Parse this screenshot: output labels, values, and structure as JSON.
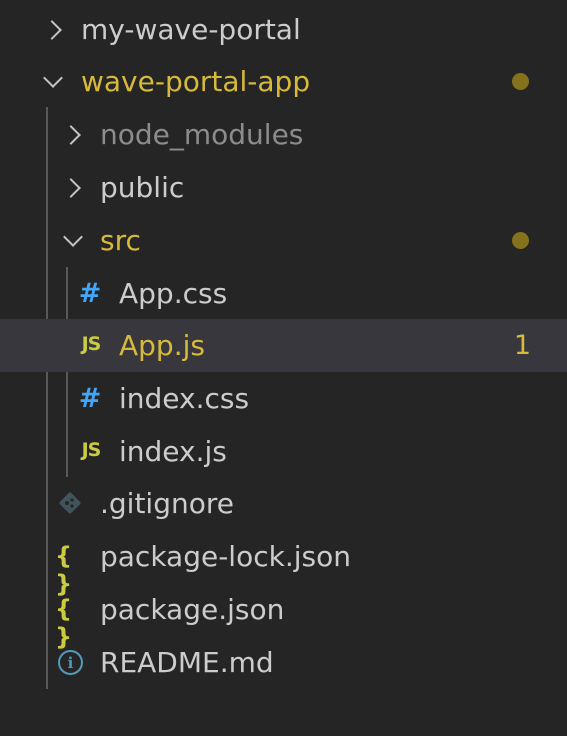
{
  "tree": {
    "root_folder": {
      "label": "my-wave-portal",
      "icon": "chevron-right-icon"
    },
    "app_folder": {
      "label": "wave-portal-app",
      "icon": "chevron-down-icon",
      "status": "modified",
      "dot_color": "#85721c"
    },
    "node_modules": {
      "label": "node_modules",
      "icon": "chevron-right-icon"
    },
    "public": {
      "label": "public",
      "icon": "chevron-right-icon"
    },
    "src": {
      "label": "src",
      "icon": "chevron-down-icon",
      "status": "modified"
    },
    "files": {
      "app_css": {
        "label": "App.css",
        "icon": "css-hash-icon",
        "glyph": "#"
      },
      "app_js": {
        "label": "App.js",
        "icon": "javascript-icon",
        "glyph": "JS",
        "badge": "1",
        "selected": true
      },
      "index_css": {
        "label": "index.css",
        "icon": "css-hash-icon",
        "glyph": "#"
      },
      "index_js": {
        "label": "index.js",
        "icon": "javascript-icon",
        "glyph": "JS"
      },
      "gitignore": {
        "label": ".gitignore",
        "icon": "git-icon"
      },
      "package_lock": {
        "label": "package-lock.json",
        "icon": "json-braces-icon",
        "glyph": "{ }"
      },
      "package_json": {
        "label": "package.json",
        "icon": "json-braces-icon",
        "glyph": "{ }"
      },
      "readme": {
        "label": "README.md",
        "icon": "info-icon",
        "glyph": "i"
      }
    }
  },
  "colors": {
    "background": "#252526",
    "selected_row": "#37373d",
    "modified_text": "#e2c08d",
    "css_icon": "#42a5f5",
    "js_icon": "#cbcb41"
  }
}
